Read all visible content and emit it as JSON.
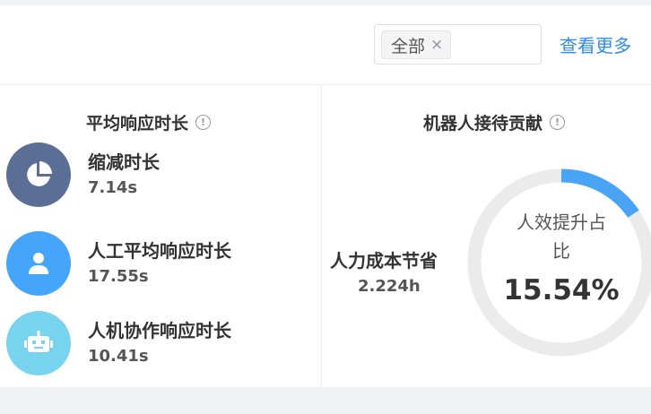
{
  "filter": {
    "selected_tag": "全部",
    "tag_close": "×"
  },
  "header": {
    "view_more": "查看更多"
  },
  "left_panel": {
    "title": "平均响应时长",
    "info": "!",
    "metrics": [
      {
        "label": "缩减时长",
        "value": "7.14s",
        "icon": "pie-chart-icon",
        "color": "#5b6e96"
      },
      {
        "label": "人工平均响应时长",
        "value": "17.55s",
        "icon": "person-icon",
        "color": "#45a5fb"
      },
      {
        "label": "人机协作响应时长",
        "value": "10.41s",
        "icon": "robot-icon",
        "color": "#78d4ee"
      }
    ]
  },
  "right_panel": {
    "title": "机器人接待贡献",
    "info": "!",
    "saving_label": "人力成本节省",
    "saving_value": "2.224h",
    "ratio_label_line1": "人效提升占",
    "ratio_label_line2": "比",
    "ratio_value": "15.54%",
    "ratio_fraction": 0.1554,
    "ring_color": "#49a4f6",
    "ring_track_color": "#ebebeb"
  }
}
